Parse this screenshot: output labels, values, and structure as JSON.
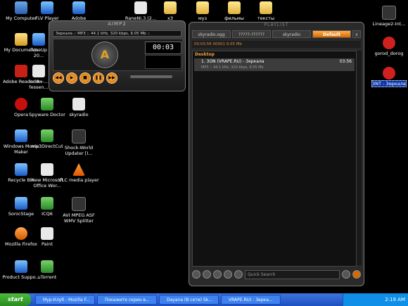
{
  "desktop_icons": [
    {
      "label": "My Computer",
      "icon": "computer-icon"
    },
    {
      "label": "FLV Player",
      "icon": "flv-player-icon"
    },
    {
      "label": "Adobe",
      "icon": "adobe-icon"
    },
    {
      "label": "RaneNi.3.(2...",
      "icon": "file-icon"
    },
    {
      "label": "x3",
      "icon": "folder-icon"
    },
    {
      "label": "муз",
      "icon": "folder-icon"
    },
    {
      "label": "фильмы",
      "icon": "folder-icon"
    },
    {
      "label": "тексты",
      "icon": "folder-icon"
    },
    {
      "label": "Lineage2-Int...",
      "icon": "game-icon"
    },
    {
      "label": "My Documents",
      "icon": "documents-icon"
    },
    {
      "label": "TuneUp 20...",
      "icon": "tuneup-icon"
    },
    {
      "label": "gorod_dorog",
      "icon": "mp3-icon"
    },
    {
      "label": "Adobe Reader 8",
      "icon": "adobe-reader-icon"
    },
    {
      "label": "indow-... fessen...",
      "icon": "window-icon"
    },
    {
      "label": "3NT - Зеркала",
      "icon": "mp3-icon"
    },
    {
      "label": "Opera",
      "icon": "opera-icon"
    },
    {
      "label": "Spyware Doctor",
      "icon": "spyware-doctor-icon"
    },
    {
      "label": "skyradio",
      "icon": "radio-icon"
    },
    {
      "label": "Windows Movie Maker",
      "icon": "movie-maker-icon"
    },
    {
      "label": "mp3DirectCut",
      "icon": "mp3directcut-icon"
    },
    {
      "label": "Shock-World Updater [I...",
      "icon": "updater-icon"
    },
    {
      "label": "Recycle Bin",
      "icon": "recycle-bin-icon"
    },
    {
      "label": "New Microsoft Office Wor...",
      "icon": "word-doc-icon"
    },
    {
      "label": "VLC media player",
      "icon": "vlc-icon"
    },
    {
      "label": "SonicStage",
      "icon": "sonicstage-icon"
    },
    {
      "label": "ICQ6",
      "icon": "icq-icon"
    },
    {
      "label": "AVI MPEG ASF WMV Splitter",
      "icon": "splitter-icon"
    },
    {
      "label": "Mozilla Firefox",
      "icon": "firefox-icon"
    },
    {
      "label": "Paint",
      "icon": "paint-icon"
    },
    {
      "label": "Product Suppo...",
      "icon": "product-support-icon"
    },
    {
      "label": "uTorrent",
      "icon": "utorrent-icon"
    }
  ],
  "aimp": {
    "title": "AIMP2",
    "track_info": "Зеркала :: MP3 :: 44.1 kHz, 320 kbps, 9.05 Mb ::",
    "time": "00:03",
    "logo": "A",
    "controls": [
      "◀◀",
      "▶",
      "■",
      "❚❚",
      "▶▶"
    ]
  },
  "playlist": {
    "title": "PLAYLIST",
    "tabs": [
      "skyradio.ogg",
      "?????-??????",
      "skyradio",
      "Default",
      "x"
    ],
    "active_tab": "Default",
    "info_line": "00:03:56     00001     9.05 Mb",
    "group": "Desktop",
    "items": [
      {
        "title": "1. 3ON (VRAPE.RU) - Зеркала",
        "meta": "MP3 :: 44.1 kHz, 320 kbps, 9.05 Mb",
        "duration": "03:56"
      }
    ],
    "search_placeholder": "Quick Search"
  },
  "taskbar": {
    "start_label": "start",
    "tasks": [
      "Мур-Клуб - Mozilla F...",
      "Покажите скрин в...",
      "Dayana (В сети) Sk...",
      "VRAPE.RU) - Зерка..."
    ],
    "clock": "2:19 AM"
  }
}
